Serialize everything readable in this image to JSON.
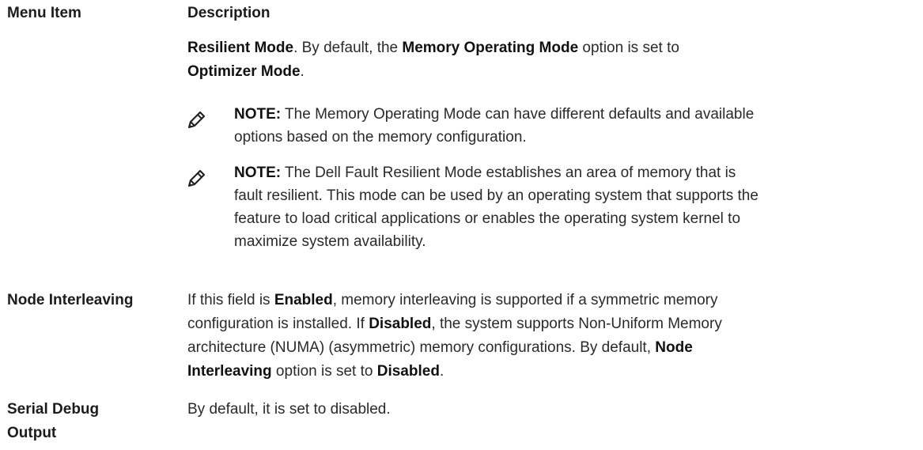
{
  "header": {
    "col1": "Menu Item",
    "col2": "Description"
  },
  "rows": [
    {
      "label": "",
      "desc_line1": {
        "b1": "Resilient Mode",
        "t1": ". By default, the ",
        "b2": "Memory Operating Mode",
        "t2": " option is set to"
      },
      "desc_line2": {
        "b1": "Optimizer Mode",
        "t1": "."
      }
    },
    {
      "label_line1": "Node Interleaving",
      "line1": {
        "t1": "If this field is ",
        "b1": "Enabled",
        "t2": ", memory interleaving is supported if a symmetric memory"
      },
      "line2": {
        "t1": "configuration is installed. If ",
        "b1": "Disabled",
        "t2": ", the system supports Non-Uniform Memory"
      },
      "line3": {
        "t1": "architecture (NUMA) (asymmetric) memory configurations. By default, ",
        "b1": "Node"
      },
      "line4": {
        "b1": "Interleaving",
        "t1": " option is set to ",
        "b2": "Disabled",
        "t2": "."
      }
    },
    {
      "label_line1": "Serial Debug",
      "label_line2": "Output",
      "desc": "By default, it is set to disabled."
    }
  ],
  "notes": [
    {
      "icon": "pencil-note-icon",
      "label": "NOTE:",
      "lines": [
        " The Memory Operating Mode can have different defaults and available",
        "options based on the memory configuration."
      ]
    },
    {
      "icon": "pencil-note-icon",
      "label": "NOTE:",
      "lines": [
        " The Dell Fault Resilient Mode establishes an area of memory that is",
        "fault resilient. This mode can be used by an operating system that supports the",
        "feature to load critical applications or enables the operating system kernel to",
        "maximize system availability."
      ]
    }
  ]
}
